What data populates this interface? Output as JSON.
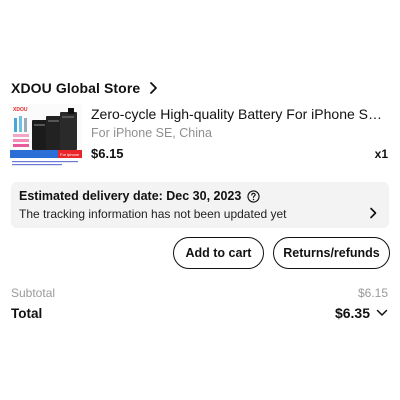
{
  "store": {
    "name": "XDOU Global Store"
  },
  "item": {
    "title": "Zero-cycle High-quality Battery For iPhone SE 5...",
    "variant": "For iPhone SE, China",
    "price": "$6.15",
    "quantity": "x1",
    "thumbnail": {
      "brand_text": "XDOU",
      "badge_text": "For iphone",
      "caption_text": "5/5S/5SE/6/6P/6S/6SP/7/7P/8/8P/X/XS/XR/XS MAX/11/11 Pro"
    }
  },
  "delivery": {
    "date_label": "Estimated delivery date: Dec 30, 2023",
    "note": "The tracking information has not been updated yet",
    "help_icon": "question-circle-icon",
    "chevron_icon": "chevron-right-icon"
  },
  "actions": {
    "add_to_cart": "Add to cart",
    "returns": "Returns/refunds"
  },
  "summary": {
    "subtotal_label": "Subtotal",
    "subtotal_value": "$6.15",
    "total_label": "Total",
    "total_value": "$6.35"
  },
  "colors": {
    "text": "#111111",
    "muted": "#8f8f8f",
    "panel": "#f3f3f3",
    "brand_red": "#e8262a"
  }
}
